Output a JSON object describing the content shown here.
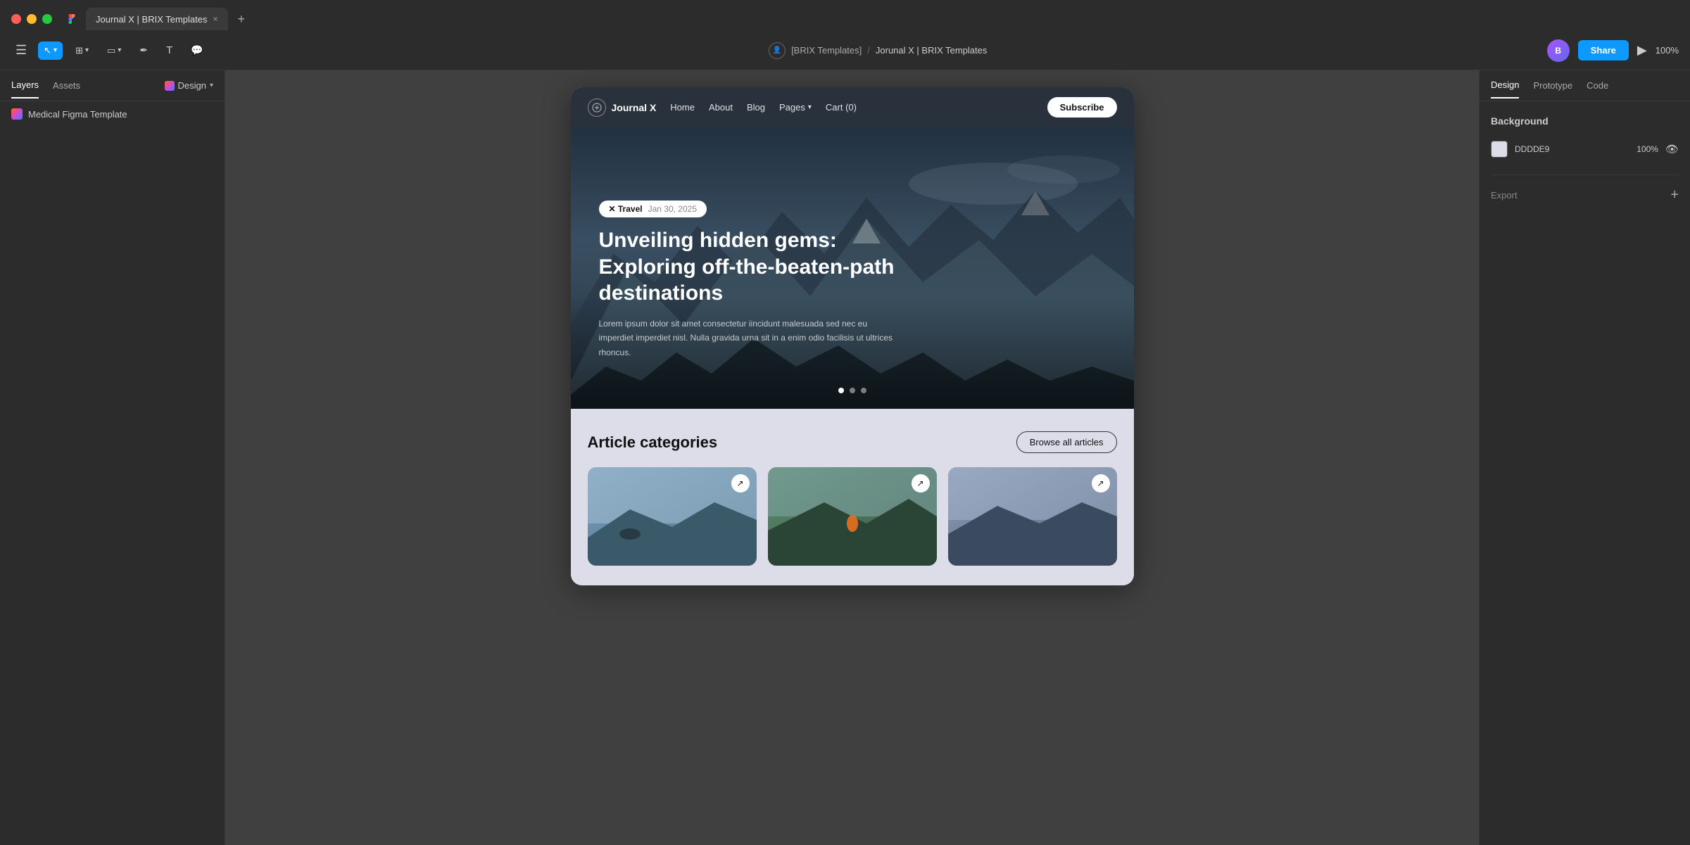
{
  "browser": {
    "tab_label": "Journal X | BRIX Templates",
    "tab_close": "×",
    "tab_new": "+"
  },
  "toolbar": {
    "menu_icon": "☰",
    "breadcrumb_user": "[BRIX Templates]",
    "breadcrumb_sep": "/",
    "breadcrumb_page": "Jorunal X | BRIX Templates",
    "share_label": "Share",
    "zoom_label": "100%"
  },
  "left_panel": {
    "tab_layers": "Layers",
    "tab_assets": "Assets",
    "design_label": "Design",
    "layer_name": "Medical Figma Template"
  },
  "right_panel": {
    "tab_design": "Design",
    "tab_prototype": "Prototype",
    "tab_code": "Code",
    "background_label": "Background",
    "bg_color_hex": "DDDDE9",
    "bg_opacity": "100%",
    "export_label": "Export",
    "export_plus": "+"
  },
  "site": {
    "logo_name": "Journal X",
    "nav_home": "Home",
    "nav_about": "About",
    "nav_blog": "Blog",
    "nav_pages": "Pages",
    "nav_cart": "Cart (0)",
    "subscribe_btn": "Subscribe",
    "hero_tag": "✕ Travel",
    "hero_date": "Jan 30, 2025",
    "hero_title": "Unveiling hidden gems: Exploring off-the-beaten-path destinations",
    "hero_desc": "Lorem ipsum dolor sit amet consectetur iincidunt malesuada sed nec eu imperdiet imperdiet nisl. Nulla gravida urna sit in a enim odio facilisis ut ultrices rhoncus.",
    "articles_title": "Article categories",
    "browse_btn": "Browse all articles"
  }
}
